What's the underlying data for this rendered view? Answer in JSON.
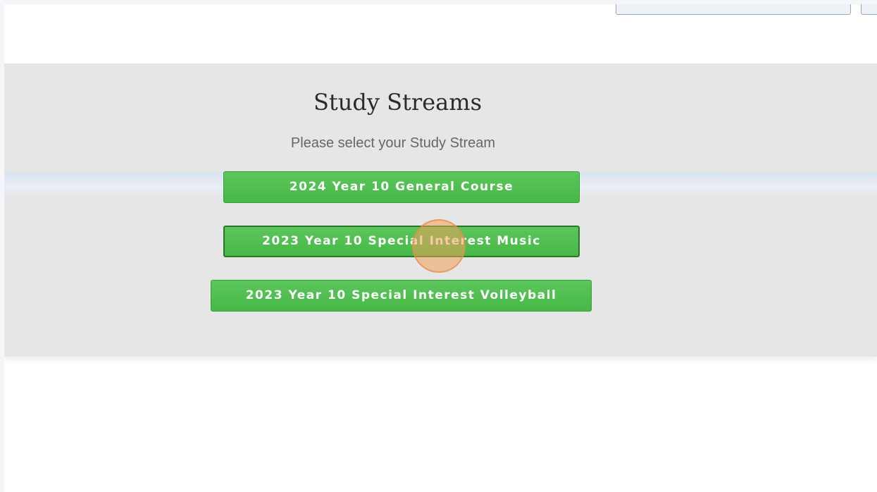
{
  "page": {
    "title": "Study Streams",
    "subtitle": "Please select your Study Stream"
  },
  "streams": [
    {
      "label": "2024 Year 10 General Course"
    },
    {
      "label": "2023 Year 10 Special Interest Music"
    },
    {
      "label": "2023 Year 10 Special Interest Volleyball"
    }
  ],
  "colors": {
    "button_green": "#4cbd4c",
    "panel_gray": "#e6e6e6",
    "cursor_highlight": "#f0a05a"
  }
}
